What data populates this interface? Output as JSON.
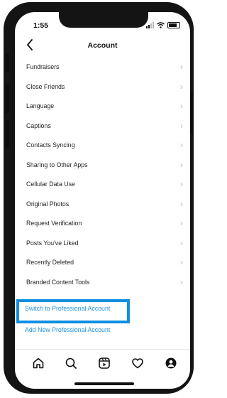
{
  "status": {
    "time": "1:55"
  },
  "header": {
    "title": "Account",
    "back_icon": "chevron-left-icon"
  },
  "menu": {
    "items": [
      {
        "label": "Fundraisers"
      },
      {
        "label": "Close Friends"
      },
      {
        "label": "Language"
      },
      {
        "label": "Captions"
      },
      {
        "label": "Contacts Syncing"
      },
      {
        "label": "Sharing to Other Apps"
      },
      {
        "label": "Cellular Data Use"
      },
      {
        "label": "Original Photos"
      },
      {
        "label": "Request Verification"
      },
      {
        "label": "Posts You've Liked"
      },
      {
        "label": "Recently Deleted"
      },
      {
        "label": "Branded Content Tools"
      }
    ]
  },
  "links": {
    "switch_professional": "Switch to Professional Account",
    "add_professional": "Add New Professional Account"
  },
  "tabbar": {
    "icons": [
      "home-icon",
      "search-icon",
      "reels-icon",
      "heart-icon",
      "profile-icon"
    ]
  },
  "colors": {
    "link": "#1a93e6",
    "highlight": "#0f8fe0"
  }
}
